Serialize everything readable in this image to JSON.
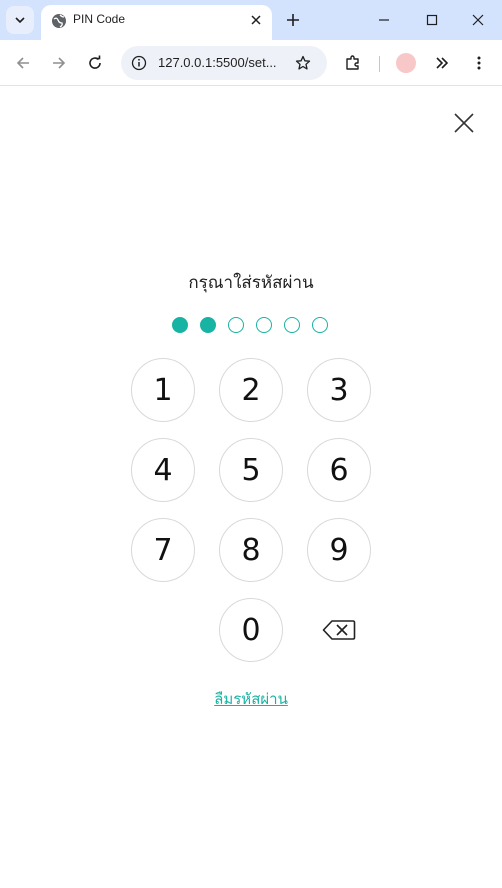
{
  "browser": {
    "tab_title": "PIN Code",
    "url": "127.0.0.1:5500/set..."
  },
  "page": {
    "title": "กรุณาใส่รหัสผ่าน",
    "pin": {
      "length": 6,
      "entered": 2
    },
    "keys": [
      "1",
      "2",
      "3",
      "4",
      "5",
      "6",
      "7",
      "8",
      "9",
      "0"
    ],
    "forgot_link": "ลืมรหัสผ่าน",
    "accent_color": "#17b3a3"
  }
}
